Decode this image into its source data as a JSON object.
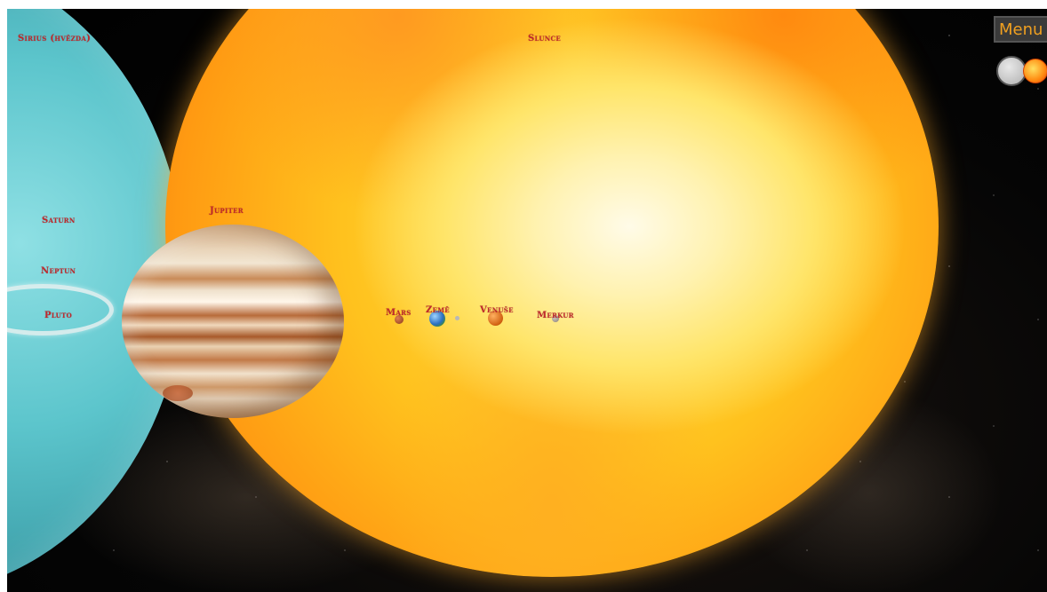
{
  "scene": {
    "bodies": [
      "uranus",
      "sun",
      "saturn",
      "jupiter",
      "mars",
      "earth",
      "moon",
      "venus",
      "mercury"
    ]
  },
  "labels": {
    "sirius": "Sirius (hvězda)",
    "slunce": "Slunce",
    "saturn": "Saturn",
    "jupiter": "Jupiter",
    "neptun": "Neptun",
    "pluto": "Pluto",
    "mars": "Mars",
    "zeme": "Země",
    "venuse": "Venuše",
    "merkur": "Merkur"
  },
  "ui": {
    "menu_label": "Menu",
    "toggle_icon_left": "circle-toggle-icon",
    "toggle_icon_right": "sun-icon"
  },
  "colors": {
    "label": "#c0282c",
    "menu_text": "#f0a020",
    "menu_bg": "#3a3a3a"
  }
}
